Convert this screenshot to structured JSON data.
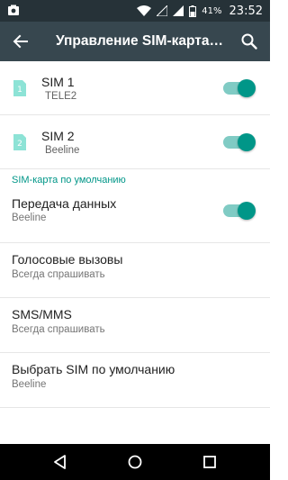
{
  "status_bar": {
    "battery_percent": "41%",
    "time": "23:52",
    "icons": [
      "photo-notification-icon",
      "wifi-icon",
      "signal-empty-icon",
      "signal-full-icon",
      "battery-icon"
    ]
  },
  "toolbar": {
    "title": "Управление SIM-карта…",
    "back_icon": "arrow-back-icon",
    "search_icon": "search-icon"
  },
  "sims": [
    {
      "title": "SIM 1",
      "carrier": "TELE2",
      "badge": "1",
      "enabled": true
    },
    {
      "title": "SIM 2",
      "carrier": "Beeline",
      "badge": "2",
      "enabled": true
    }
  ],
  "section": {
    "header": "SIM-карта по умолчанию"
  },
  "prefs": [
    {
      "title": "Передача данных",
      "value": "Beeline",
      "toggle": true
    },
    {
      "title": "Голосовые вызовы",
      "value": "Всегда спрашивать"
    },
    {
      "title": "SMS/MMS",
      "value": "Всегда спрашивать"
    },
    {
      "title": "Выбрать SIM по умолчанию",
      "value": "Beeline"
    }
  ],
  "colors": {
    "status_bar": "#263238",
    "toolbar": "#37474f",
    "accent": "#009688",
    "sim_icon": "#8de3d6"
  },
  "nav_bar": {
    "icons": [
      "back-triangle-icon",
      "home-circle-icon",
      "recents-square-icon"
    ]
  }
}
